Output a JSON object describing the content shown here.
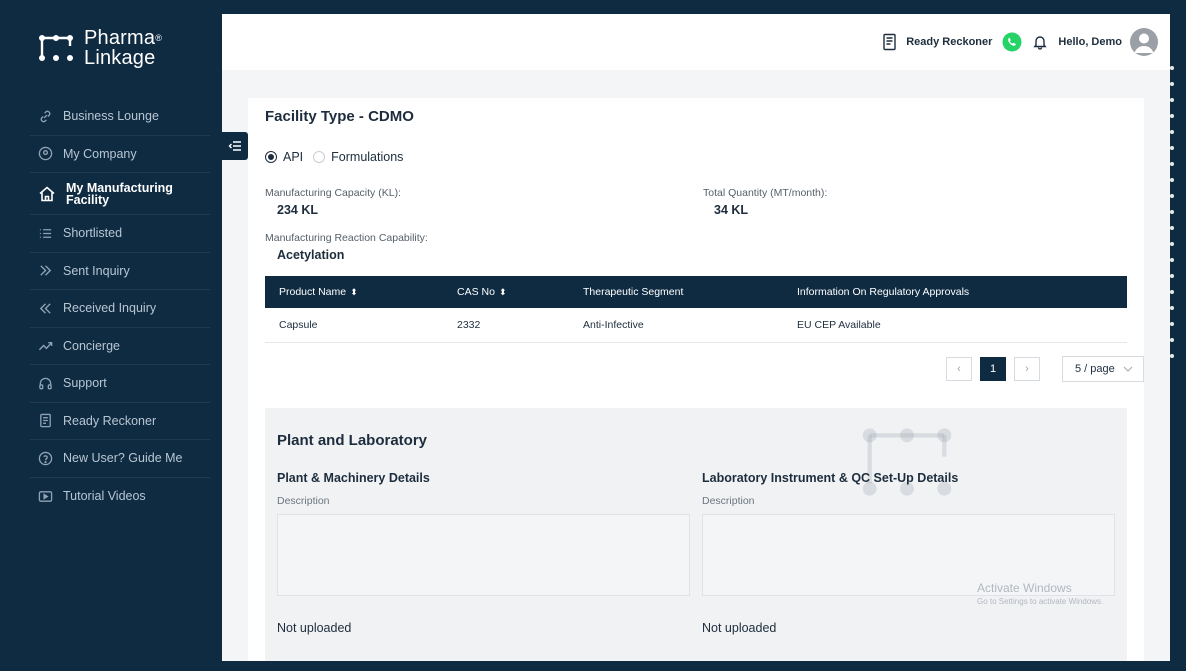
{
  "brand": {
    "line1": "Pharma",
    "line2": "Linkage",
    "reg": "®"
  },
  "sidebar": {
    "items": [
      {
        "label": "Business Lounge",
        "icon": "link-icon"
      },
      {
        "label": "My Company",
        "icon": "location-pin-icon"
      },
      {
        "label": "My Manufacturing Facility",
        "icon": "home-icon",
        "active": true
      },
      {
        "label": "Shortlisted",
        "icon": "list-icon"
      },
      {
        "label": "Sent Inquiry",
        "icon": "double-chevron-right-icon"
      },
      {
        "label": "Received Inquiry",
        "icon": "double-chevron-left-icon"
      },
      {
        "label": "Concierge",
        "icon": "trend-line-icon"
      },
      {
        "label": "Support",
        "icon": "headset-icon"
      },
      {
        "label": "Ready Reckoner",
        "icon": "document-icon"
      },
      {
        "label": "New User? Guide Me",
        "icon": "help-circle-icon"
      },
      {
        "label": "Tutorial Videos",
        "icon": "video-icon"
      }
    ]
  },
  "header": {
    "ready_reckoner": "Ready Reckoner",
    "greeting": "Hello, Demo"
  },
  "facility": {
    "title": "Facility Type - CDMO",
    "radio_api": "API",
    "radio_formulations": "Formulations",
    "selected": "API",
    "capacity_label": "Manufacturing Capacity (KL):",
    "capacity_value": "234 KL",
    "quantity_label": "Total Quantity (MT/month):",
    "quantity_value": "34 KL",
    "reaction_label": "Manufacturing Reaction Capability:",
    "reaction_value": "Acetylation"
  },
  "table": {
    "headers": [
      "Product Name",
      "CAS No",
      "Therapeutic Segment",
      "Information On Regulatory Approvals"
    ],
    "rows": [
      [
        "Capsule",
        "2332",
        "Anti-Infective",
        "EU CEP Available"
      ]
    ]
  },
  "pagination": {
    "current": "1",
    "page_size": "5 / page"
  },
  "plant": {
    "title": "Plant and Laboratory",
    "machinery_title": "Plant & Machinery Details",
    "lab_title": "Laboratory Instrument & QC Set-Up Details",
    "description_label": "Description",
    "machinery_status": "Not uploaded",
    "lab_status": "Not uploaded"
  },
  "os_overlay": {
    "line1": "Activate Windows",
    "line2": "Go to Settings to activate Windows."
  },
  "colors": {
    "navy": "#0f2b42",
    "whatsapp": "#25d366"
  }
}
